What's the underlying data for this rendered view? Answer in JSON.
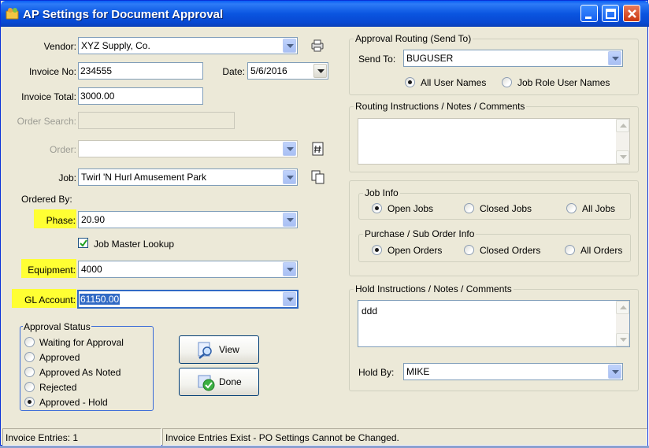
{
  "window": {
    "title": "AP Settings for Document Approval",
    "app_icon": "folder-people-icon"
  },
  "form": {
    "vendor_label": "Vendor:",
    "vendor_value": "XYZ Supply, Co.",
    "invoice_no_label": "Invoice No:",
    "invoice_no_value": "234555",
    "date_label": "Date:",
    "date_value": "5/6/2016",
    "invoice_total_label": "Invoice Total:",
    "invoice_total_value": "3000.00",
    "order_search_label": "Order Search:",
    "order_search_value": "",
    "order_label": "Order:",
    "order_value": "",
    "job_label": "Job:",
    "job_value": "Twirl 'N Hurl Amusement Park",
    "ordered_by_label": "Ordered By:",
    "phase_label": "Phase:",
    "phase_value": "20.90",
    "job_master_lookup_label": "Job Master Lookup",
    "job_master_lookup_checked": true,
    "equipment_label": "Equipment:",
    "equipment_value": "4000",
    "gl_account_label": "GL Account:",
    "gl_account_value": "61150.00",
    "highlight_color": "#ffff33"
  },
  "approval_status": {
    "legend": "Approval Status",
    "options": [
      "Waiting for Approval",
      "Approved",
      "Approved As Noted",
      "Rejected",
      "Approved - Hold"
    ],
    "selected": "Approved - Hold"
  },
  "buttons": {
    "view_label": "View",
    "done_label": "Done"
  },
  "routing": {
    "legend": "Approval Routing (Send To)",
    "send_to_label": "Send To:",
    "send_to_value": "BUGUSER",
    "option_all": "All User Names",
    "option_role": "Job Role User Names",
    "selected": "All User Names"
  },
  "routing_instructions": {
    "legend": "Routing Instructions / Notes / Comments",
    "value": ""
  },
  "job_info": {
    "legend": "Job Info",
    "options": [
      "Open Jobs",
      "Closed Jobs",
      "All Jobs"
    ],
    "selected": "Open Jobs"
  },
  "purchase_info": {
    "legend": "Purchase / Sub Order Info",
    "options": [
      "Open Orders",
      "Closed Orders",
      "All Orders"
    ],
    "selected": "Open Orders"
  },
  "hold": {
    "legend": "Hold Instructions / Notes / Comments",
    "value": "ddd",
    "hold_by_label": "Hold By:",
    "hold_by_value": "MIKE"
  },
  "status_bar": {
    "entries": "Invoice Entries: 1",
    "message": "Invoice Entries Exist - PO Settings Cannot be Changed."
  }
}
